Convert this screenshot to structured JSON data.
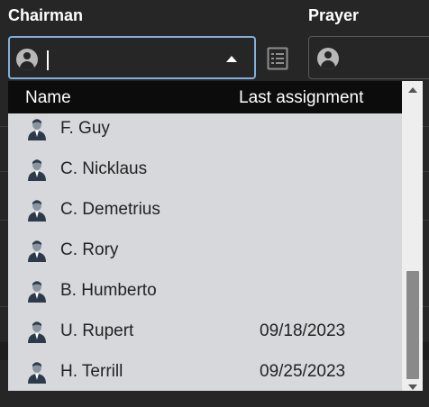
{
  "chairman": {
    "label": "Chairman",
    "value": "",
    "icon": "person-circle-icon",
    "dropdown_state": "open"
  },
  "prayer": {
    "label": "Prayer",
    "value": "",
    "icon": "person-circle-icon"
  },
  "list_view_icon": "list-view-icon",
  "dropdown": {
    "header": {
      "name": "Name",
      "last_assignment": "Last assignment"
    },
    "rows": [
      {
        "name": "F. Guy",
        "last_assignment": ""
      },
      {
        "name": "C. Nicklaus",
        "last_assignment": ""
      },
      {
        "name": "C. Demetrius",
        "last_assignment": ""
      },
      {
        "name": "C. Rory",
        "last_assignment": ""
      },
      {
        "name": "B. Humberto",
        "last_assignment": ""
      },
      {
        "name": "U. Rupert",
        "last_assignment": "09/18/2023"
      },
      {
        "name": "H. Terrill",
        "last_assignment": "09/25/2023"
      }
    ],
    "scroll_position": 0.82
  },
  "colors": {
    "background": "#262626",
    "focus_border": "#7fb0de",
    "dropdown_bg": "#d6d8dc",
    "header_bg": "#0c0c0c"
  }
}
